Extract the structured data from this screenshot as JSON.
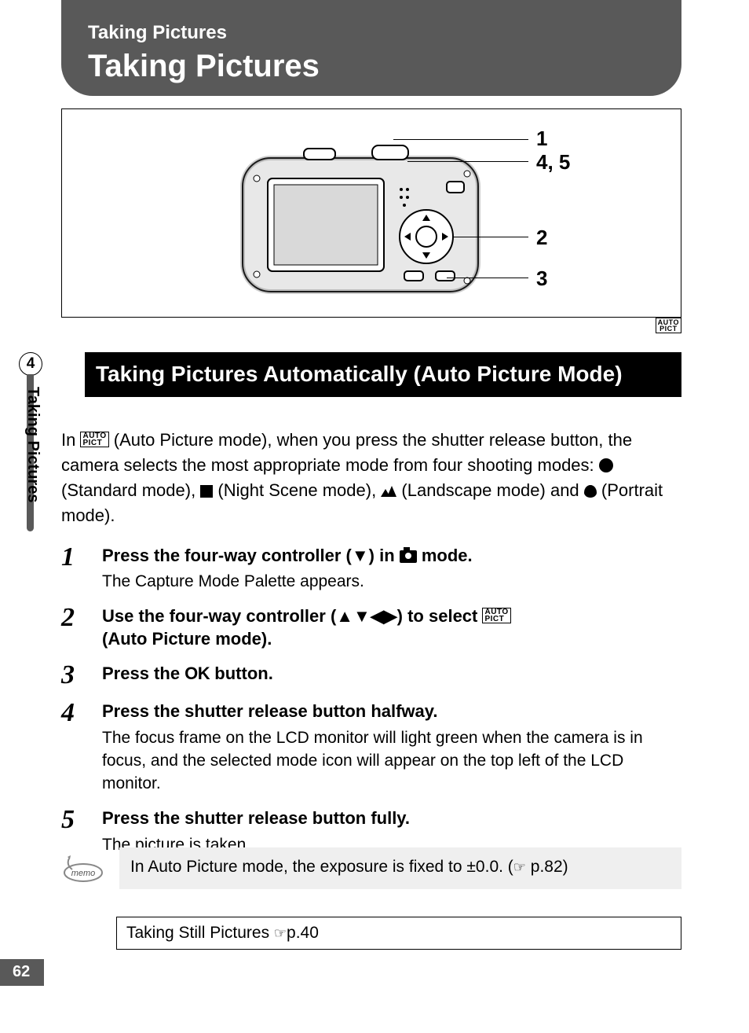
{
  "header": {
    "small": "Taking Pictures",
    "large": "Taking Pictures"
  },
  "diagram": {
    "callouts": [
      "1",
      "4, 5",
      "2",
      "3"
    ]
  },
  "auto_pict_badge": "AUTO\nPICT",
  "side_tab": {
    "number": "4",
    "label": "Taking Pictures"
  },
  "section_title": "Taking Pictures Automatically (Auto Picture Mode)",
  "intro": {
    "prefix": "In ",
    "after_badge": " (Auto Picture mode), when you press the shutter release button, the camera selects the most appropriate mode from four shooting modes: ",
    "std": " (Standard mode), ",
    "night": " (Night Scene mode), ",
    "land": " (Landscape mode) and ",
    "port": " (Portrait mode)."
  },
  "steps": [
    {
      "num": "1",
      "title_pre": "Press the four-way controller (",
      "title_arrow": "▼",
      "title_mid": ") in ",
      "title_post": " mode.",
      "desc": "The Capture Mode Palette appears."
    },
    {
      "num": "2",
      "title_pre": "Use the four-way controller (",
      "title_arrows": "▲▼◀▶",
      "title_mid": ") to select ",
      "title_post": " (Auto Picture mode).",
      "desc": ""
    },
    {
      "num": "3",
      "title_pre": "Press the ",
      "ok": "OK",
      "title_post": " button.",
      "desc": ""
    },
    {
      "num": "4",
      "title": "Press the shutter release button halfway.",
      "desc": "The focus frame on the LCD monitor will light green when the camera is in focus, and the selected mode icon will appear on the top left of the LCD monitor."
    },
    {
      "num": "5",
      "title": "Press the shutter release button fully.",
      "desc": "The picture is taken."
    }
  ],
  "memo": {
    "label": "memo",
    "text_pre": "In Auto Picture mode, the exposure is fixed to ±0.0. (",
    "pointer": "☞",
    "text_post": " p.82)"
  },
  "ref": {
    "text": "Taking Still Pictures ",
    "pointer": "☞",
    "page": "p.40"
  },
  "page_number": "62"
}
